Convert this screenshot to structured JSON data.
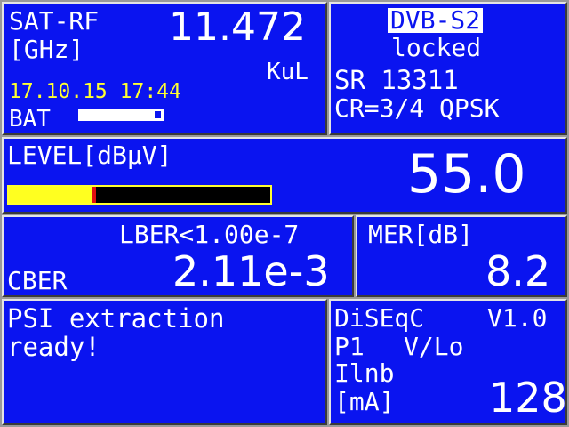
{
  "sat": {
    "title": "SAT-RF",
    "unit": "[GHz]",
    "frequency": "11.472",
    "band": "KuL",
    "datetime": "17.10.15 17:44",
    "bat_label": "BAT",
    "battery_level": 0.92
  },
  "signal": {
    "standard": "DVB-S2",
    "status": "locked",
    "sr": "SR 13311",
    "cr": "CR=3/4 QPSK"
  },
  "level": {
    "label": "LEVEL[dBµV]",
    "value": "55.0",
    "bar_fill_fraction": 0.32
  },
  "ber": {
    "lber": "LBER<1.00e-7",
    "cber_label": "CBER",
    "cber_value": "2.11e-3"
  },
  "mer": {
    "label": "MER[dB]",
    "value": "8.2"
  },
  "psi": {
    "line1": "PSI extraction",
    "line2": "ready!"
  },
  "diseqc": {
    "label": "DiSEqC",
    "version": "V1.0",
    "port": "P1",
    "pol": "V/Lo",
    "ilnb": "Ilnb",
    "unit": "[mA]",
    "current": "128"
  },
  "colors": {
    "panel_bg": "#0a14f0",
    "text": "#ffffff",
    "accent_yellow": "#ffff30",
    "marker_red": "#e01010"
  }
}
